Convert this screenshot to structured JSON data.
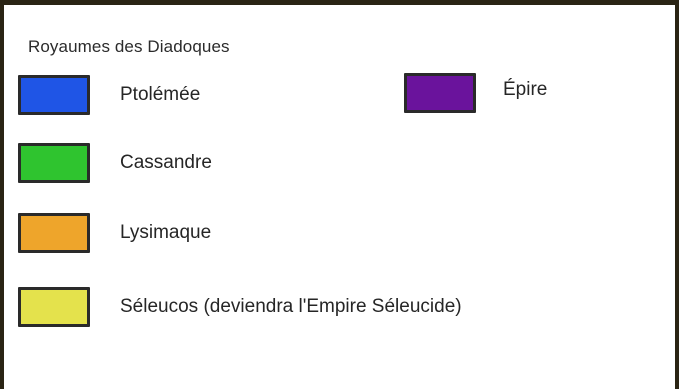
{
  "legend": {
    "title": "Royaumes des Diadoques",
    "items": [
      {
        "label": "Ptolémée",
        "color": "#1f55e6"
      },
      {
        "label": "Épire",
        "color": "#6a139c"
      },
      {
        "label": "Cassandre",
        "color": "#2fc42f"
      },
      {
        "label": "Lysimaque",
        "color": "#eea52b"
      },
      {
        "label": "Séleucos (deviendra l'Empire Séleucide)",
        "color": "#e4e24c"
      }
    ]
  }
}
